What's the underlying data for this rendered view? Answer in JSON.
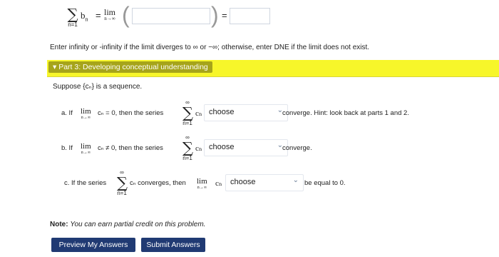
{
  "top_formula": {
    "sigma": "∑",
    "sigma_bottom": "n=1",
    "term": "b",
    "sub": "n",
    "eq": "=",
    "lim": "lim",
    "lim_sub": "n→∞",
    "eq2": "="
  },
  "instruction": "Enter infinity or -infinity if the limit diverges to ∞ or −∞; otherwise, enter DNE if the limit does not exist.",
  "part3": {
    "toggle": "▾",
    "title": "Part 3: Developing conceptual understanding"
  },
  "suppose": "Suppose {cₙ} is a sequence.",
  "items": [
    {
      "letter": "a. If",
      "lim": "lim",
      "lim_sub": "n→∞",
      "cond": "cₙ = 0, then the series",
      "sigma_top": "∞",
      "sigma_bot": "n=1",
      "term": "cₙ",
      "select": "choose",
      "after": "converge. Hint: look back at parts 1 and 2."
    },
    {
      "letter": "b. If",
      "lim": "lim",
      "lim_sub": "n→∞",
      "cond": "cₙ ≠ 0, then the series",
      "sigma_top": "∞",
      "sigma_bot": "n=1",
      "term": "cₙ",
      "select": "choose",
      "after": "converge."
    },
    {
      "letter": "c. If the series",
      "sigma_top": "∞",
      "sigma_bot": "n=1",
      "term": "cₙ converges, then",
      "lim": "lim",
      "lim_sub": "n→∞",
      "lim_term": "cₙ",
      "select": "choose",
      "after": "be equal to 0."
    }
  ],
  "note": {
    "bold": "Note:",
    "italic": "You can earn partial credit on this problem."
  },
  "buttons": {
    "preview": "Preview My Answers",
    "submit": "Submit Answers"
  },
  "icons": {
    "chevron": "chevron-down-icon"
  },
  "colors": {
    "part_bar": "#f7f62a",
    "part_title_bg": "#a6a41a",
    "button_bg": "#203a73"
  }
}
